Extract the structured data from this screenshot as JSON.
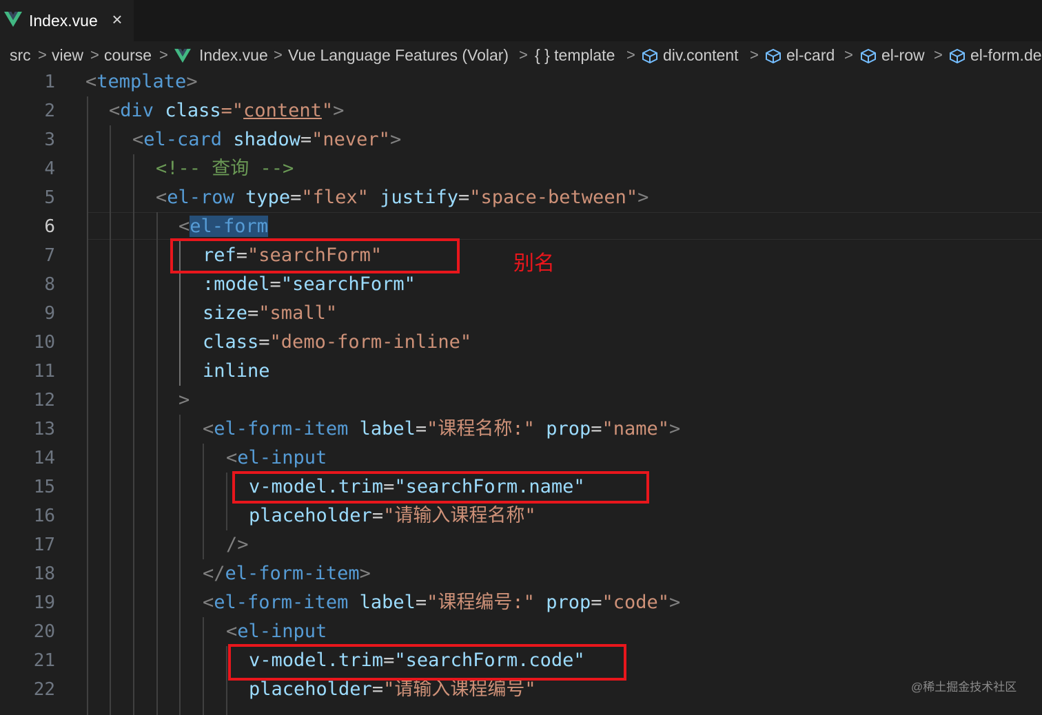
{
  "tab": {
    "title": "Index.vue",
    "icon": "vue-icon",
    "close_icon": "close-icon"
  },
  "breadcrumb": {
    "items": [
      "src",
      "view",
      "course",
      "Index.vue",
      "Vue Language Features (Volar)",
      "{ } template",
      "div.content",
      "el-card",
      "el-row",
      "el-form.de"
    ],
    "separator": ">"
  },
  "editor": {
    "active_line": 6,
    "line_numbers": [
      "1",
      "2",
      "3",
      "4",
      "5",
      "6",
      "7",
      "8",
      "9",
      "10",
      "11",
      "12",
      "13",
      "14",
      "15",
      "16",
      "17",
      "18",
      "19",
      "20",
      "21",
      "22"
    ],
    "lines": [
      {
        "tokens": [
          [
            "<",
            "punc"
          ],
          [
            "template",
            "tag"
          ],
          [
            ">",
            "punc"
          ]
        ]
      },
      {
        "tokens": [
          [
            "<",
            "punc"
          ],
          [
            "div",
            "tag"
          ],
          [
            " ",
            "eq"
          ],
          [
            "class",
            "attr"
          ],
          [
            "=\"",
            "str"
          ],
          [
            "content",
            "strlink"
          ],
          [
            "\"",
            "str"
          ],
          [
            ">",
            "punc"
          ]
        ]
      },
      {
        "tokens": [
          [
            "<",
            "punc"
          ],
          [
            "el-card",
            "tag"
          ],
          [
            " ",
            "eq"
          ],
          [
            "shadow",
            "attr"
          ],
          [
            "=",
            "eq"
          ],
          [
            "\"never\"",
            "str"
          ],
          [
            ">",
            "punc"
          ]
        ]
      },
      {
        "tokens": [
          [
            "<!-- 查询 -->",
            "com"
          ]
        ]
      },
      {
        "tokens": [
          [
            "<",
            "punc"
          ],
          [
            "el-row",
            "tag"
          ],
          [
            " ",
            "eq"
          ],
          [
            "type",
            "attr"
          ],
          [
            "=",
            "eq"
          ],
          [
            "\"flex\"",
            "str"
          ],
          [
            " ",
            "eq"
          ],
          [
            "justify",
            "attr"
          ],
          [
            "=",
            "eq"
          ],
          [
            "\"space-between\"",
            "str"
          ],
          [
            ">",
            "punc"
          ]
        ]
      },
      {
        "tokens": [
          [
            "<",
            "punc"
          ],
          [
            "el-form",
            "tagsel"
          ]
        ]
      },
      {
        "tokens": [
          [
            "ref",
            "attr"
          ],
          [
            "=",
            "eq"
          ],
          [
            "\"searchForm\"",
            "str"
          ]
        ]
      },
      {
        "tokens": [
          [
            ":model",
            "attr"
          ],
          [
            "=",
            "eq"
          ],
          [
            "\"searchForm\"",
            "attr"
          ]
        ]
      },
      {
        "tokens": [
          [
            "size",
            "attr"
          ],
          [
            "=",
            "eq"
          ],
          [
            "\"small\"",
            "str"
          ]
        ]
      },
      {
        "tokens": [
          [
            "class",
            "attr"
          ],
          [
            "=",
            "eq"
          ],
          [
            "\"demo-form-inline\"",
            "str"
          ]
        ]
      },
      {
        "tokens": [
          [
            "inline",
            "attr"
          ]
        ]
      },
      {
        "tokens": [
          [
            ">",
            "punc"
          ]
        ]
      },
      {
        "tokens": [
          [
            "<",
            "punc"
          ],
          [
            "el-form-item",
            "tag"
          ],
          [
            " ",
            "eq"
          ],
          [
            "label",
            "attr"
          ],
          [
            "=",
            "eq"
          ],
          [
            "\"课程名称:\"",
            "str"
          ],
          [
            " ",
            "eq"
          ],
          [
            "prop",
            "attr"
          ],
          [
            "=",
            "eq"
          ],
          [
            "\"name\"",
            "str"
          ],
          [
            ">",
            "punc"
          ]
        ]
      },
      {
        "tokens": [
          [
            "<",
            "punc"
          ],
          [
            "el-input",
            "tag"
          ]
        ]
      },
      {
        "tokens": [
          [
            "v-model.trim",
            "attr"
          ],
          [
            "=",
            "eq"
          ],
          [
            "\"searchForm.name\"",
            "attr"
          ]
        ]
      },
      {
        "tokens": [
          [
            "placeholder",
            "attr"
          ],
          [
            "=",
            "eq"
          ],
          [
            "\"请输入课程名称\"",
            "str"
          ]
        ]
      },
      {
        "tokens": [
          [
            "/>",
            "punc"
          ]
        ]
      },
      {
        "tokens": [
          [
            "</",
            "punc"
          ],
          [
            "el-form-item",
            "tag"
          ],
          [
            ">",
            "punc"
          ]
        ]
      },
      {
        "tokens": [
          [
            "<",
            "punc"
          ],
          [
            "el-form-item",
            "tag"
          ],
          [
            " ",
            "eq"
          ],
          [
            "label",
            "attr"
          ],
          [
            "=",
            "eq"
          ],
          [
            "\"课程编号:\"",
            "str"
          ],
          [
            " ",
            "eq"
          ],
          [
            "prop",
            "attr"
          ],
          [
            "=",
            "eq"
          ],
          [
            "\"code\"",
            "str"
          ],
          [
            ">",
            "punc"
          ]
        ]
      },
      {
        "tokens": [
          [
            "<",
            "punc"
          ],
          [
            "el-input",
            "tag"
          ]
        ]
      },
      {
        "tokens": [
          [
            "v-model.trim",
            "attr"
          ],
          [
            "=",
            "eq"
          ],
          [
            "\"searchForm.code\"",
            "attr"
          ]
        ]
      },
      {
        "tokens": [
          [
            "placeholder",
            "attr"
          ],
          [
            "=",
            "eq"
          ],
          [
            "\"请输入课程编号\"",
            "str"
          ]
        ]
      }
    ]
  },
  "annotation": {
    "text": "别名",
    "color": "#e8161c"
  },
  "watermark": "@稀土掘金技术社区",
  "colors": {
    "background": "#1f1f1f",
    "tag": "#569cd6",
    "attr": "#9cdcfe",
    "string": "#ce9178",
    "comment": "#6a9955",
    "highlight": "#e8161c"
  }
}
